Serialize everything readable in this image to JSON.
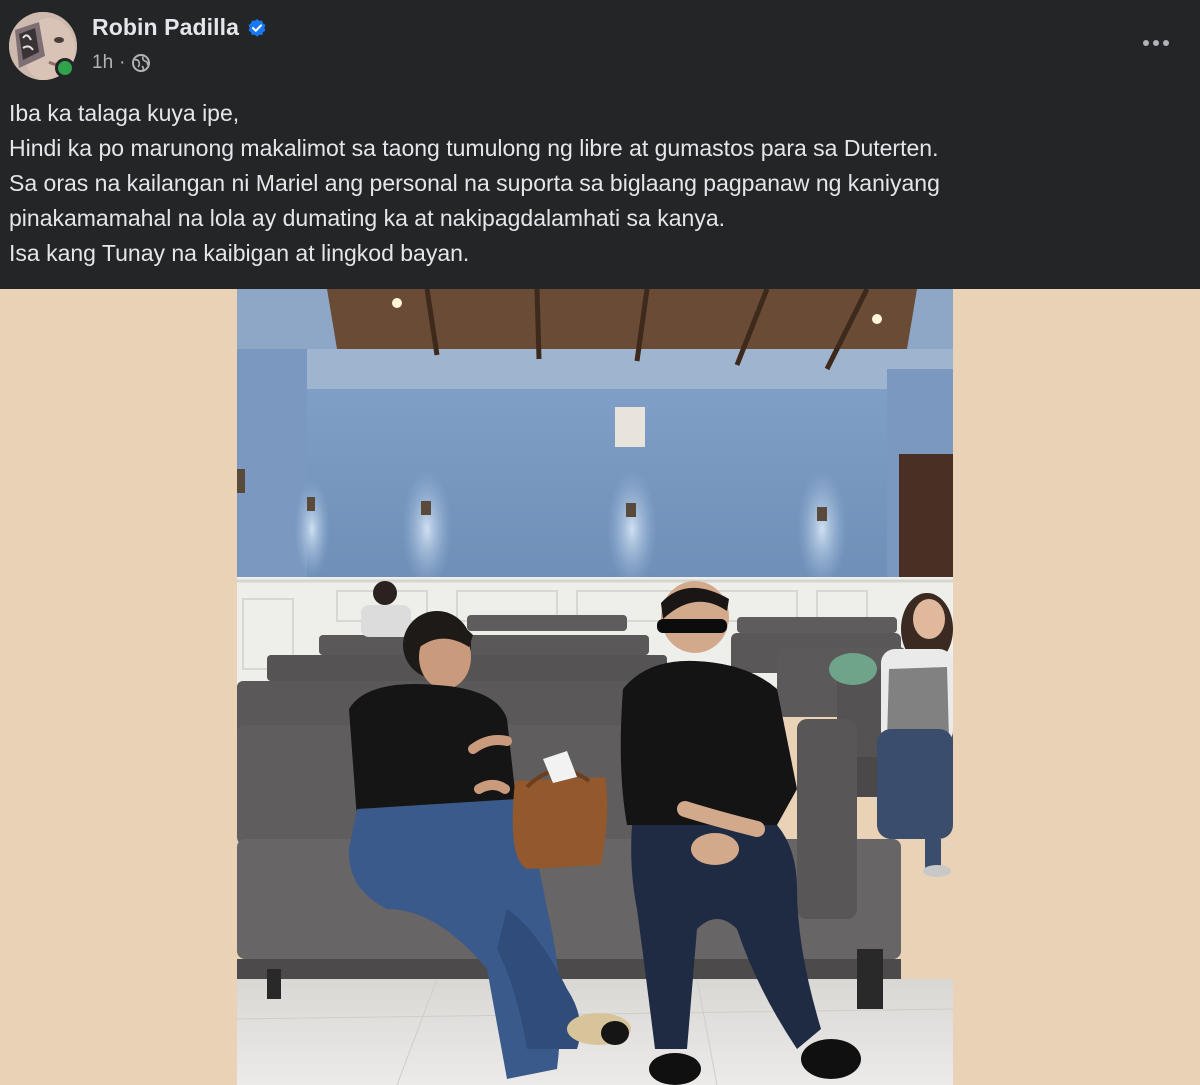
{
  "post": {
    "author": {
      "name": "Robin Padilla",
      "verified": true,
      "online": true
    },
    "meta": {
      "time": "1h",
      "separator": "·",
      "audience_icon": "globe-icon"
    },
    "more_icon": "more-horizontal-icon",
    "text_lines": [
      "Iba ka talaga kuya ipe,",
      "Hindi ka po marunong makalimot sa taong tumulong ng libre at gumastos para sa Duterten.",
      "Sa oras na kailangan ni Mariel ang personal na suporta sa biglaang pagpanaw ng kaniyang",
      "pinakamamahal na lola ay dumating ka at nakipagdalamhati sa kanya.",
      "Isa kang Tunay na kaibigan at lingkod bayan."
    ],
    "media": {
      "background_color": "#ead2b7"
    }
  },
  "colors": {
    "card_background": "#242526",
    "primary_text": "#e4e6eb",
    "secondary_text": "#b0b3b8",
    "verified_blue": "#1877f2",
    "online_green": "#31a24c"
  }
}
